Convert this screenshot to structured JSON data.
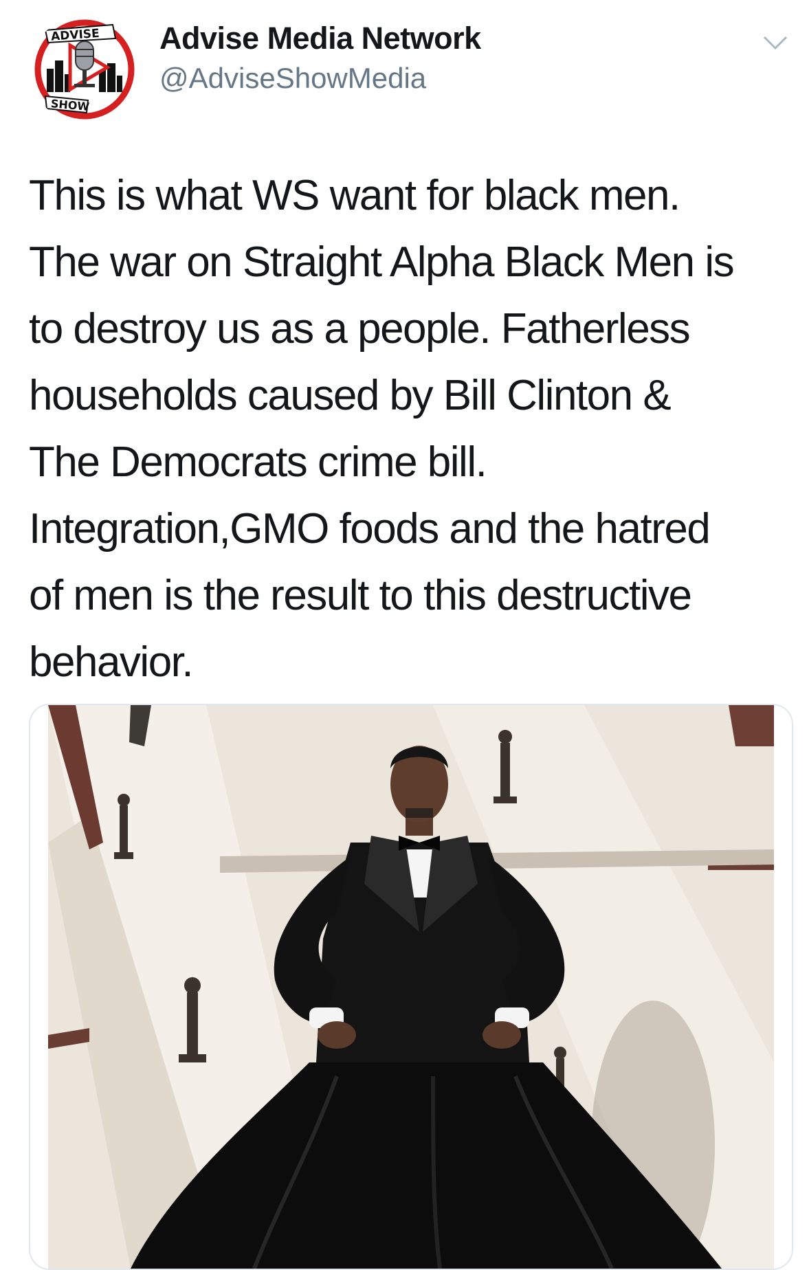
{
  "account": {
    "display_name": "Advise Media Network",
    "handle": "@AdviseShowMedia",
    "avatar_logo_text_top": "ADVISE",
    "avatar_logo_text_bottom": "SHOW"
  },
  "tweet": {
    "text_lines": [
      "This is what WS want for black men.",
      "The war on Straight Alpha Black Men is",
      "to destroy us as a people. Fatherless",
      "households caused by Bill Clinton &",
      "The Democrats crime bill.",
      "Integration,GMO foods and the hatred",
      "of men is the result to this destructive",
      "behavior."
    ]
  },
  "icons": {
    "menu": "chevron-down-icon",
    "avatar": "microphone-logo-icon"
  },
  "colors": {
    "text": "#14171a",
    "secondary_text": "#657786",
    "logo_red": "#d42020",
    "card_border": "#e1e8ed"
  }
}
